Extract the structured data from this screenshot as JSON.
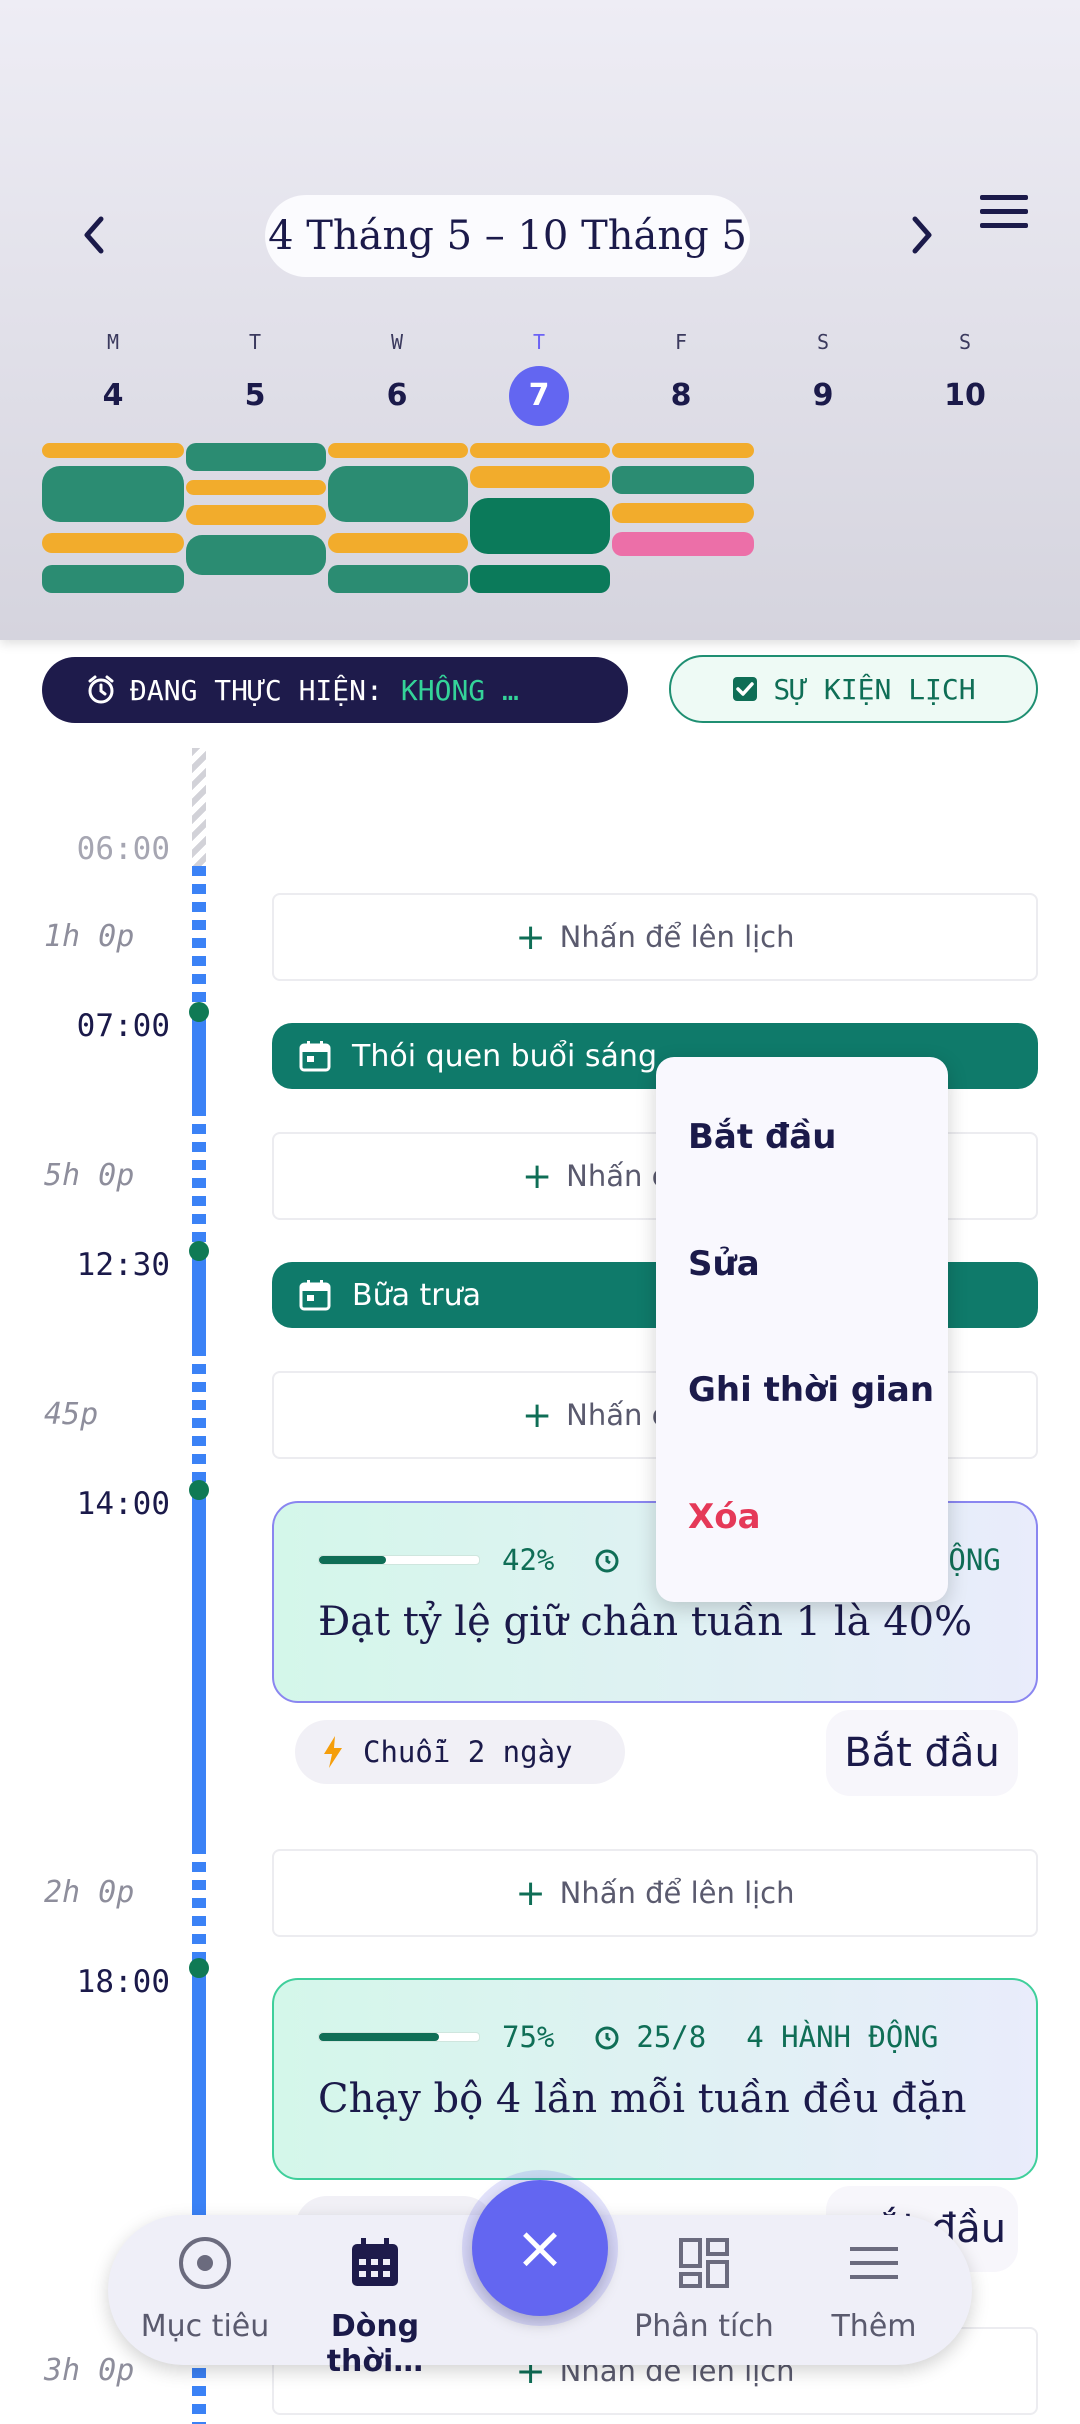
{
  "header": {
    "date_range": "4 Tháng 5 – 10 Tháng 5",
    "days": [
      {
        "dow": "M",
        "num": "4"
      },
      {
        "dow": "T",
        "num": "5"
      },
      {
        "dow": "W",
        "num": "6"
      },
      {
        "dow": "T",
        "num": "7",
        "today": true
      },
      {
        "dow": "F",
        "num": "8"
      },
      {
        "dow": "S",
        "num": "9"
      },
      {
        "dow": "S",
        "num": "10"
      }
    ]
  },
  "status": {
    "current_label": "ĐANG THỰC HIỆN:",
    "current_value": "KHÔNG …",
    "calendar_events_label": "SỰ KIỆN LỊCH"
  },
  "timeline": {
    "times": [
      "06:00",
      "07:00",
      "12:30",
      "14:00",
      "18:00"
    ],
    "gaps": [
      "1h 0p",
      "5h 0p",
      "45p",
      "2h 0p",
      "3h 0p"
    ],
    "slot_label": "Nhấn để lên lịch",
    "slot_label_truncated": "Nhấn c",
    "events": [
      "Thói quen buổi sáng",
      "Bữa trưa"
    ],
    "goals": [
      {
        "progress": "42%",
        "progress_value": 0.42,
        "meta_tail": "ỘNG",
        "title": "Đạt tỷ lệ giữ chân tuần 1 là 40%"
      },
      {
        "progress": "75%",
        "progress_value": 0.75,
        "deadline": "25/8",
        "actions": "4 HÀNH ĐỘNG",
        "title": "Chạy bộ 4 lần mỗi tuần đều đặn"
      }
    ],
    "streak_label": "Chuỗi 2 ngày",
    "start_label": "Bắt đầu",
    "start_label_partial": "ắt đầu"
  },
  "context_menu": {
    "items": [
      "Bắt đầu",
      "Sửa",
      "Ghi thời gian",
      "Xóa"
    ]
  },
  "bottom_nav": {
    "items": [
      "Mục tiêu",
      "Dòng thời…",
      "Phân tích",
      "Thêm"
    ],
    "fab_symbol": "×"
  },
  "colors": {
    "accent": "#6366f1",
    "teal": "#0f7a6a",
    "yellow_bar": "#f2ac2c",
    "pink_bar": "#ec6fa8",
    "danger": "#e53958",
    "rail": "#3b82f6"
  }
}
